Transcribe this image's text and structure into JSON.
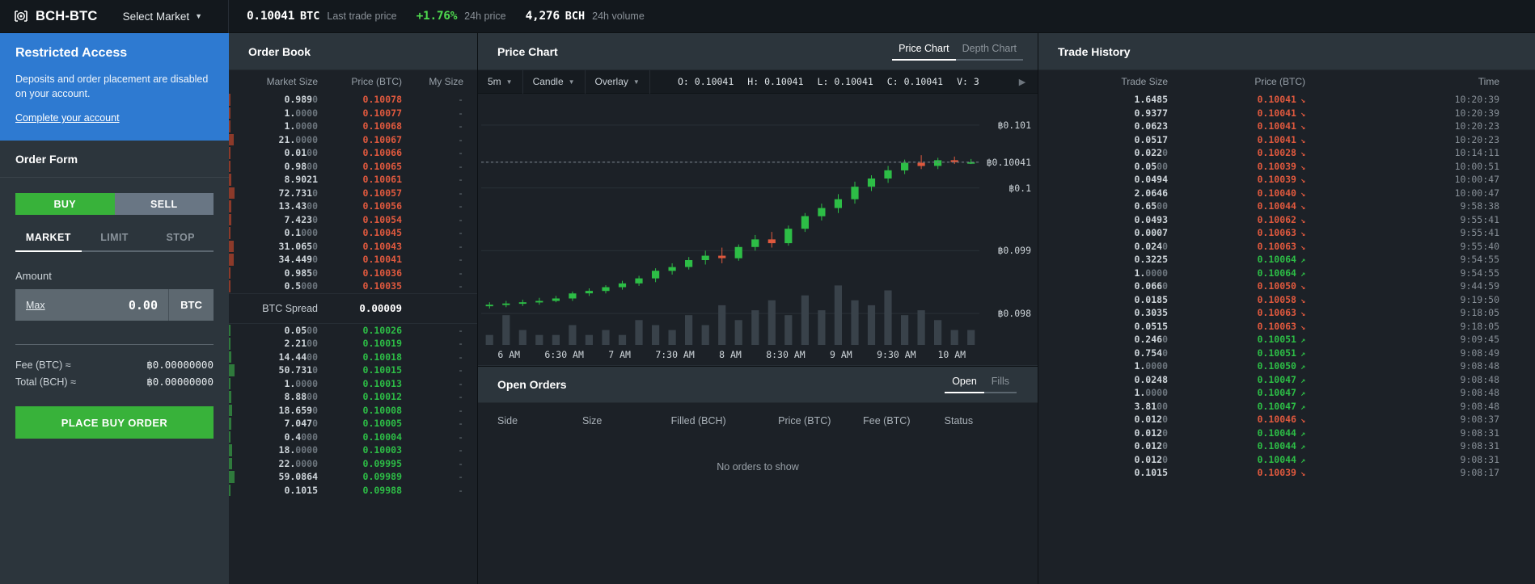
{
  "topbar": {
    "logo_icon": "coinbase-logo-icon",
    "pair": "BCH-BTC",
    "select_market": "Select Market",
    "last_price": "0.10041",
    "last_price_unit": "BTC",
    "last_price_label": "Last trade price",
    "change_pct": "+1.76%",
    "change_label": "24h price",
    "volume": "4,276",
    "volume_unit": "BCH",
    "volume_label": "24h volume"
  },
  "notice": {
    "title": "Restricted Access",
    "body": "Deposits and order placement are disabled on your account.",
    "link": "Complete your account"
  },
  "order_form": {
    "title": "Order Form",
    "buy_label": "BUY",
    "sell_label": "SELL",
    "tabs": [
      {
        "label": "MARKET",
        "active": true
      },
      {
        "label": "LIMIT",
        "active": false
      },
      {
        "label": "STOP",
        "active": false
      }
    ],
    "amount_label": "Amount",
    "max_label": "Max",
    "amount_value": "0.00",
    "amount_unit": "BTC",
    "fee_label": "Fee (BTC) ≈",
    "fee_value": "฿0.00000000",
    "total_label": "Total (BCH) ≈",
    "total_value": "฿0.00000000",
    "place_button": "PLACE BUY ORDER"
  },
  "order_book": {
    "title": "Order Book",
    "columns": {
      "size": "Market Size",
      "price": "Price (BTC)",
      "mine": "My Size"
    },
    "spread_label": "BTC Spread",
    "spread_value": "0.00009",
    "asks": [
      {
        "size": "0.989",
        "size_dim": "0",
        "price": "0.10078",
        "mine": "-",
        "depth": 2
      },
      {
        "size": "1.",
        "size_dim": "0000",
        "price": "0.10077",
        "mine": "-",
        "depth": 2
      },
      {
        "size": "1.",
        "size_dim": "0000",
        "price": "0.10068",
        "mine": "-",
        "depth": 2
      },
      {
        "size": "21.",
        "size_dim": "0000",
        "price": "0.10067",
        "mine": "-",
        "depth": 5
      },
      {
        "size": "0.01",
        "size_dim": "00",
        "price": "0.10066",
        "mine": "-",
        "depth": 2
      },
      {
        "size": "0.98",
        "size_dim": "00",
        "price": "0.10065",
        "mine": "-",
        "depth": 2
      },
      {
        "size": "8.9021",
        "size_dim": "",
        "price": "0.10061",
        "mine": "-",
        "depth": 3
      },
      {
        "size": "72.731",
        "size_dim": "0",
        "price": "0.10057",
        "mine": "-",
        "depth": 6
      },
      {
        "size": "13.43",
        "size_dim": "00",
        "price": "0.10056",
        "mine": "-",
        "depth": 3
      },
      {
        "size": "7.423",
        "size_dim": "0",
        "price": "0.10054",
        "mine": "-",
        "depth": 3
      },
      {
        "size": "0.1",
        "size_dim": "000",
        "price": "0.10045",
        "mine": "-",
        "depth": 2
      },
      {
        "size": "31.065",
        "size_dim": "0",
        "price": "0.10043",
        "mine": "-",
        "depth": 5
      },
      {
        "size": "34.449",
        "size_dim": "0",
        "price": "0.10041",
        "mine": "-",
        "depth": 5
      },
      {
        "size": "0.985",
        "size_dim": "0",
        "price": "0.10036",
        "mine": "-",
        "depth": 2
      },
      {
        "size": "0.5",
        "size_dim": "000",
        "price": "0.10035",
        "mine": "-",
        "depth": 2
      }
    ],
    "bids": [
      {
        "size": "0.05",
        "size_dim": "00",
        "price": "0.10026",
        "mine": "-",
        "depth": 2
      },
      {
        "size": "2.21",
        "size_dim": "00",
        "price": "0.10019",
        "mine": "-",
        "depth": 2
      },
      {
        "size": "14.44",
        "size_dim": "00",
        "price": "0.10018",
        "mine": "-",
        "depth": 3
      },
      {
        "size": "50.731",
        "size_dim": "0",
        "price": "0.10015",
        "mine": "-",
        "depth": 6
      },
      {
        "size": "1.",
        "size_dim": "0000",
        "price": "0.10013",
        "mine": "-",
        "depth": 2
      },
      {
        "size": "8.88",
        "size_dim": "00",
        "price": "0.10012",
        "mine": "-",
        "depth": 3
      },
      {
        "size": "18.659",
        "size_dim": "0",
        "price": "0.10008",
        "mine": "-",
        "depth": 4
      },
      {
        "size": "7.047",
        "size_dim": "0",
        "price": "0.10005",
        "mine": "-",
        "depth": 3
      },
      {
        "size": "0.4",
        "size_dim": "000",
        "price": "0.10004",
        "mine": "-",
        "depth": 2
      },
      {
        "size": "18.",
        "size_dim": "0000",
        "price": "0.10003",
        "mine": "-",
        "depth": 4
      },
      {
        "size": "22.",
        "size_dim": "0000",
        "price": "0.09995",
        "mine": "-",
        "depth": 4
      },
      {
        "size": "59.0864",
        "size_dim": "",
        "price": "0.09989",
        "mine": "-",
        "depth": 6
      },
      {
        "size": "0.1015",
        "size_dim": "",
        "price": "0.09988",
        "mine": "-",
        "depth": 2
      }
    ]
  },
  "chart": {
    "title": "Price Chart",
    "tabs": [
      {
        "label": "Price Chart",
        "active": true
      },
      {
        "label": "Depth Chart",
        "active": false
      }
    ],
    "toolbar": {
      "interval": "5m",
      "type": "Candle",
      "overlay": "Overlay",
      "play_icon": "play-icon"
    },
    "ohlc": {
      "o_label": "O:",
      "o": "0.10041",
      "h_label": "H:",
      "h": "0.10041",
      "l_label": "L:",
      "l": "0.10041",
      "c_label": "C:",
      "c": "0.10041",
      "v_label": "V:",
      "v": "3"
    }
  },
  "chart_data": {
    "type": "line",
    "title": "Price Chart",
    "xlabel": "",
    "ylabel": "",
    "ylim": [
      0.0975,
      0.1015
    ],
    "grid": false,
    "legend": "none",
    "y_ticks": [
      "฿0.101",
      "฿0.10041",
      "฿0.1",
      "฿0.099",
      "฿0.098"
    ],
    "y_tick_values": [
      0.101,
      0.10041,
      0.1,
      0.099,
      0.098
    ],
    "x_ticks": [
      "6 AM",
      "6:30 AM",
      "7 AM",
      "7:30 AM",
      "8 AM",
      "8:30 AM",
      "9 AM",
      "9:30 AM",
      "10 AM"
    ],
    "candles": [
      {
        "o": 0.09812,
        "h": 0.09818,
        "l": 0.09808,
        "c": 0.09814,
        "v": 2,
        "up": true
      },
      {
        "o": 0.09814,
        "h": 0.0982,
        "l": 0.0981,
        "c": 0.09816,
        "v": 6,
        "up": true
      },
      {
        "o": 0.09816,
        "h": 0.09822,
        "l": 0.09812,
        "c": 0.09818,
        "v": 3,
        "up": true
      },
      {
        "o": 0.09818,
        "h": 0.09825,
        "l": 0.09814,
        "c": 0.0982,
        "v": 2,
        "up": true
      },
      {
        "o": 0.0982,
        "h": 0.09828,
        "l": 0.09818,
        "c": 0.09824,
        "v": 2,
        "up": true
      },
      {
        "o": 0.09824,
        "h": 0.09835,
        "l": 0.0982,
        "c": 0.09832,
        "v": 4,
        "up": true
      },
      {
        "o": 0.09832,
        "h": 0.0984,
        "l": 0.09828,
        "c": 0.09836,
        "v": 2,
        "up": true
      },
      {
        "o": 0.09836,
        "h": 0.09845,
        "l": 0.09832,
        "c": 0.09842,
        "v": 3,
        "up": true
      },
      {
        "o": 0.09842,
        "h": 0.09852,
        "l": 0.09838,
        "c": 0.09848,
        "v": 2,
        "up": true
      },
      {
        "o": 0.09848,
        "h": 0.0986,
        "l": 0.09844,
        "c": 0.09856,
        "v": 5,
        "up": true
      },
      {
        "o": 0.09856,
        "h": 0.09872,
        "l": 0.0985,
        "c": 0.09868,
        "v": 4,
        "up": true
      },
      {
        "o": 0.09868,
        "h": 0.0988,
        "l": 0.09862,
        "c": 0.09874,
        "v": 3,
        "up": true
      },
      {
        "o": 0.09874,
        "h": 0.0989,
        "l": 0.0987,
        "c": 0.09885,
        "v": 6,
        "up": true
      },
      {
        "o": 0.09885,
        "h": 0.099,
        "l": 0.09878,
        "c": 0.09892,
        "v": 4,
        "up": true
      },
      {
        "o": 0.09892,
        "h": 0.09905,
        "l": 0.0988,
        "c": 0.09888,
        "v": 8,
        "up": false
      },
      {
        "o": 0.09888,
        "h": 0.0991,
        "l": 0.09884,
        "c": 0.09906,
        "v": 5,
        "up": true
      },
      {
        "o": 0.09906,
        "h": 0.09925,
        "l": 0.099,
        "c": 0.09918,
        "v": 7,
        "up": true
      },
      {
        "o": 0.09918,
        "h": 0.0993,
        "l": 0.09905,
        "c": 0.09912,
        "v": 9,
        "up": false
      },
      {
        "o": 0.09912,
        "h": 0.0994,
        "l": 0.09908,
        "c": 0.09935,
        "v": 6,
        "up": true
      },
      {
        "o": 0.09935,
        "h": 0.0996,
        "l": 0.0993,
        "c": 0.09955,
        "v": 10,
        "up": true
      },
      {
        "o": 0.09955,
        "h": 0.09975,
        "l": 0.09948,
        "c": 0.09968,
        "v": 7,
        "up": true
      },
      {
        "o": 0.09968,
        "h": 0.0999,
        "l": 0.0996,
        "c": 0.09982,
        "v": 12,
        "up": true
      },
      {
        "o": 0.09982,
        "h": 0.1001,
        "l": 0.09975,
        "c": 0.10002,
        "v": 9,
        "up": true
      },
      {
        "o": 0.10002,
        "h": 0.1002,
        "l": 0.09995,
        "c": 0.10015,
        "v": 8,
        "up": true
      },
      {
        "o": 0.10015,
        "h": 0.10035,
        "l": 0.10008,
        "c": 0.10028,
        "v": 11,
        "up": true
      },
      {
        "o": 0.10028,
        "h": 0.10045,
        "l": 0.10022,
        "c": 0.1004,
        "v": 6,
        "up": true
      },
      {
        "o": 0.1004,
        "h": 0.10052,
        "l": 0.1003,
        "c": 0.10035,
        "v": 7,
        "up": false
      },
      {
        "o": 0.10035,
        "h": 0.10048,
        "l": 0.1003,
        "c": 0.10044,
        "v": 5,
        "up": true
      },
      {
        "o": 0.10044,
        "h": 0.1005,
        "l": 0.10038,
        "c": 0.10041,
        "v": 3,
        "up": false
      },
      {
        "o": 0.10041,
        "h": 0.10046,
        "l": 0.10038,
        "c": 0.10041,
        "v": 3,
        "up": true
      }
    ]
  },
  "open_orders": {
    "title": "Open Orders",
    "tabs": [
      {
        "label": "Open",
        "active": true
      },
      {
        "label": "Fills",
        "active": false
      }
    ],
    "columns": [
      "Side",
      "Size",
      "Filled (BCH)",
      "Price (BTC)",
      "Fee (BTC)",
      "Status"
    ],
    "empty_message": "No orders to show"
  },
  "trade_history": {
    "title": "Trade History",
    "columns": {
      "size": "Trade Size",
      "price": "Price (BTC)",
      "time": "Time"
    },
    "rows": [
      {
        "size": "1.6485",
        "size_dim": "",
        "price": "0.10041",
        "dir": "down",
        "time": "10:20:39"
      },
      {
        "size": "0.9377",
        "size_dim": "",
        "price": "0.10041",
        "dir": "down",
        "time": "10:20:39"
      },
      {
        "size": "0.0623",
        "size_dim": "",
        "price": "0.10041",
        "dir": "down",
        "time": "10:20:23"
      },
      {
        "size": "0.0517",
        "size_dim": "",
        "price": "0.10041",
        "dir": "down",
        "time": "10:20:23"
      },
      {
        "size": "0.022",
        "size_dim": "0",
        "price": "0.10028",
        "dir": "down",
        "time": "10:14:11"
      },
      {
        "size": "0.05",
        "size_dim": "00",
        "price": "0.10039",
        "dir": "down",
        "time": "10:00:51"
      },
      {
        "size": "0.0494",
        "size_dim": "",
        "price": "0.10039",
        "dir": "down",
        "time": "10:00:47"
      },
      {
        "size": "2.0646",
        "size_dim": "",
        "price": "0.10040",
        "dir": "down",
        "time": "10:00:47"
      },
      {
        "size": "0.65",
        "size_dim": "00",
        "price": "0.10044",
        "dir": "down",
        "time": "9:58:38"
      },
      {
        "size": "0.0493",
        "size_dim": "",
        "price": "0.10062",
        "dir": "down",
        "time": "9:55:41"
      },
      {
        "size": "0.0007",
        "size_dim": "",
        "price": "0.10063",
        "dir": "down",
        "time": "9:55:41"
      },
      {
        "size": "0.024",
        "size_dim": "0",
        "price": "0.10063",
        "dir": "down",
        "time": "9:55:40"
      },
      {
        "size": "0.3225",
        "size_dim": "",
        "price": "0.10064",
        "dir": "up",
        "time": "9:54:55"
      },
      {
        "size": "1.",
        "size_dim": "0000",
        "price": "0.10064",
        "dir": "up",
        "time": "9:54:55"
      },
      {
        "size": "0.066",
        "size_dim": "0",
        "price": "0.10050",
        "dir": "down",
        "time": "9:44:59"
      },
      {
        "size": "0.0185",
        "size_dim": "",
        "price": "0.10058",
        "dir": "down",
        "time": "9:19:50"
      },
      {
        "size": "0.3035",
        "size_dim": "",
        "price": "0.10063",
        "dir": "down",
        "time": "9:18:05"
      },
      {
        "size": "0.0515",
        "size_dim": "",
        "price": "0.10063",
        "dir": "down",
        "time": "9:18:05"
      },
      {
        "size": "0.246",
        "size_dim": "0",
        "price": "0.10051",
        "dir": "up",
        "time": "9:09:45"
      },
      {
        "size": "0.754",
        "size_dim": "0",
        "price": "0.10051",
        "dir": "up",
        "time": "9:08:49"
      },
      {
        "size": "1.",
        "size_dim": "0000",
        "price": "0.10050",
        "dir": "up",
        "time": "9:08:48"
      },
      {
        "size": "0.0248",
        "size_dim": "",
        "price": "0.10047",
        "dir": "up",
        "time": "9:08:48"
      },
      {
        "size": "1.",
        "size_dim": "0000",
        "price": "0.10047",
        "dir": "up",
        "time": "9:08:48"
      },
      {
        "size": "3.81",
        "size_dim": "00",
        "price": "0.10047",
        "dir": "up",
        "time": "9:08:48"
      },
      {
        "size": "0.012",
        "size_dim": "0",
        "price": "0.10046",
        "dir": "down",
        "time": "9:08:37"
      },
      {
        "size": "0.012",
        "size_dim": "0",
        "price": "0.10044",
        "dir": "up",
        "time": "9:08:31"
      },
      {
        "size": "0.012",
        "size_dim": "0",
        "price": "0.10044",
        "dir": "up",
        "time": "9:08:31"
      },
      {
        "size": "0.012",
        "size_dim": "0",
        "price": "0.10044",
        "dir": "up",
        "time": "9:08:31"
      },
      {
        "size": "0.1015",
        "size_dim": "",
        "price": "0.10039",
        "dir": "down",
        "time": "9:08:17"
      }
    ]
  }
}
